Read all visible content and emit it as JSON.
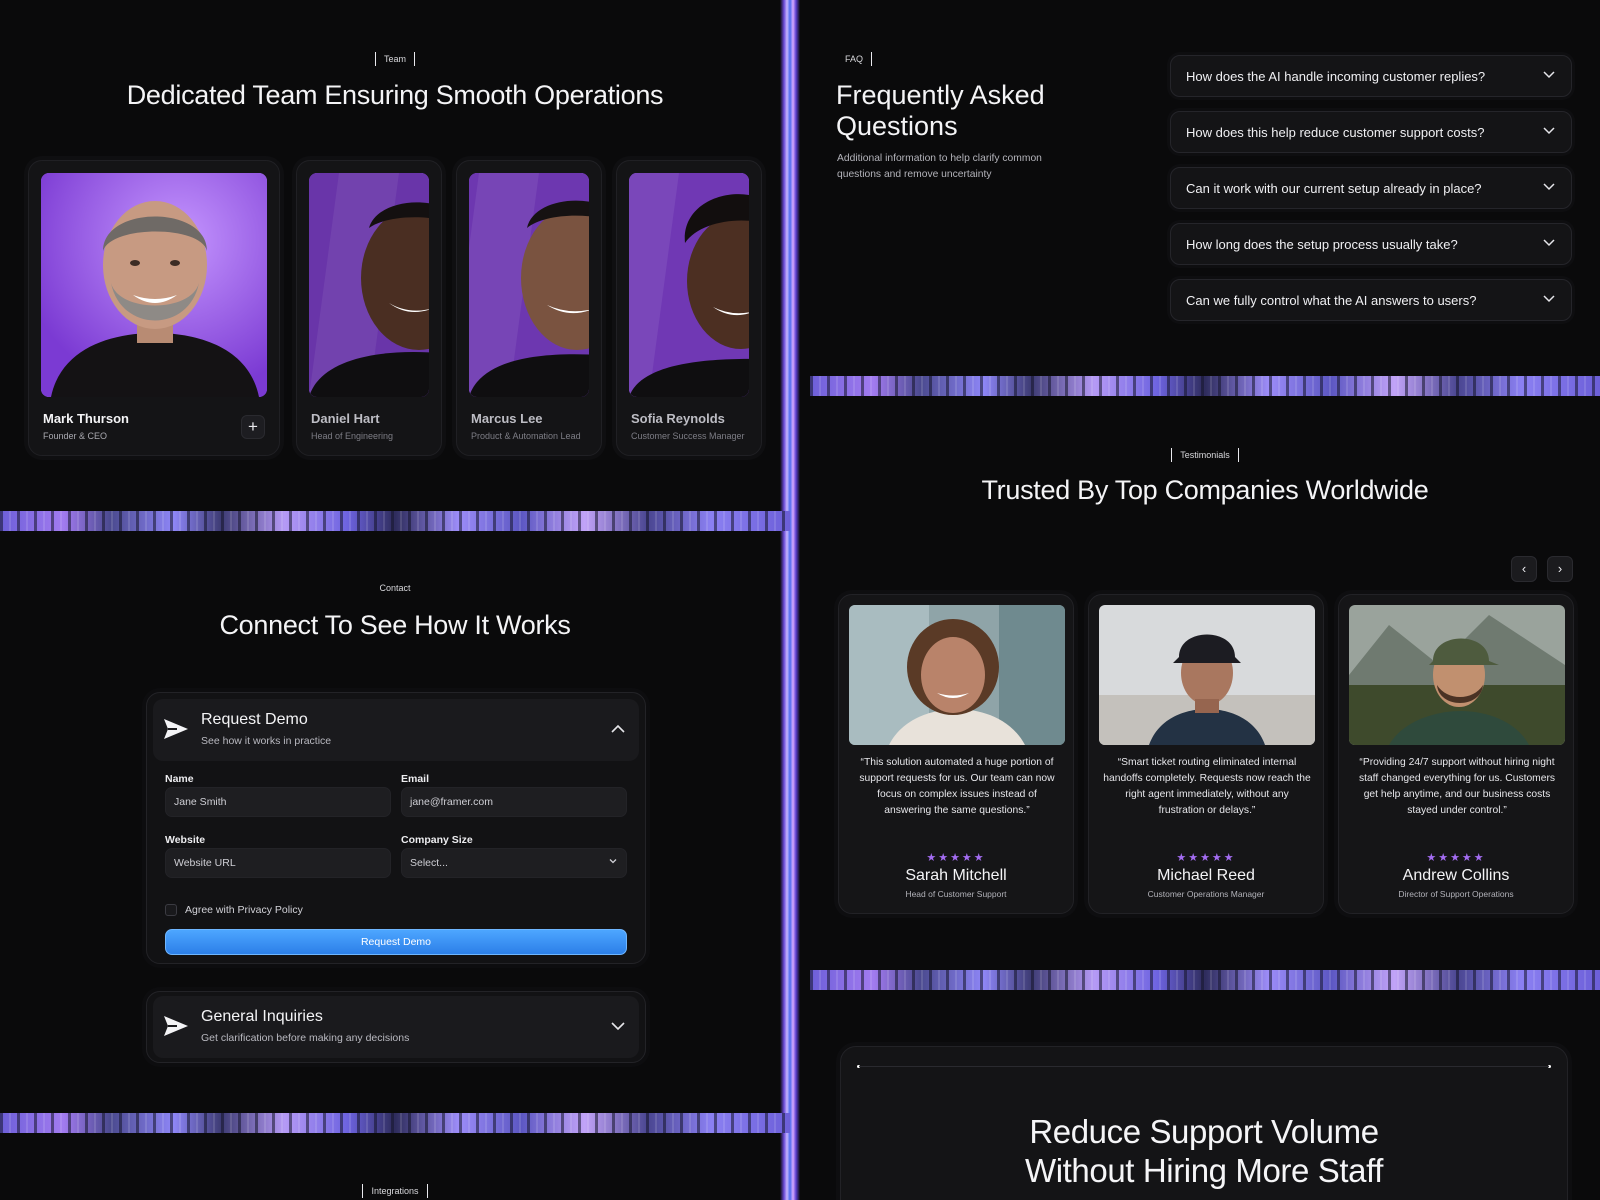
{
  "team": {
    "eyebrow": "Team",
    "title": "Dedicated Team Ensuring Smooth Operations",
    "members": [
      {
        "name": "Mark Thurson",
        "role": "Founder & CEO"
      },
      {
        "name": "Daniel Hart",
        "role": "Head of Engineering"
      },
      {
        "name": "Marcus Lee",
        "role": "Product & Automation Lead"
      },
      {
        "name": "Sofia Reynolds",
        "role": "Customer Success Manager"
      }
    ],
    "expand_symbol": "+"
  },
  "contact": {
    "eyebrow": "Contact",
    "title": "Connect To See How It Works",
    "demo": {
      "title": "Request Demo",
      "subtitle": "See how it works in practice",
      "name_label": "Name",
      "name_value": "Jane Smith",
      "email_label": "Email",
      "email_value": "jane@framer.com",
      "website_label": "Website",
      "website_placeholder": "Website URL",
      "size_label": "Company Size",
      "size_value": "Select...",
      "privacy_label": "Agree with Privacy Policy",
      "submit_label": "Request Demo"
    },
    "general": {
      "title": "General Inquiries",
      "subtitle": "Get clarification before making any decisions"
    }
  },
  "integrations": {
    "eyebrow": "Integrations"
  },
  "faq": {
    "eyebrow": "FAQ",
    "title_line1": "Frequently Asked",
    "title_line2": "Questions",
    "subtitle_line1": "Additional information to help clarify common",
    "subtitle_line2": "questions and remove uncertainty",
    "questions": [
      "How does the AI handle incoming customer replies?",
      "How does this help reduce customer support costs?",
      "Can it work with our current setup already in place?",
      "How long does the setup process usually take?",
      "Can we fully control what the AI answers to users?"
    ]
  },
  "testimonials": {
    "eyebrow": "Testimonials",
    "title": "Trusted By Top Companies Worldwide",
    "prev_symbol": "‹",
    "next_symbol": "›",
    "items": [
      {
        "quote": "“This solution automated a huge portion of support requests for us. Our team can now focus on complex issues instead of answering the same questions.”",
        "stars": "★★★★★",
        "rating": 5,
        "name": "Sarah Mitchell",
        "role": "Head of Customer Support"
      },
      {
        "quote": "“Smart ticket routing eliminated internal handoffs completely. Requests now reach the right agent immediately, without any frustration or delays.”",
        "stars": "★★★★★",
        "rating": 5,
        "name": "Michael Reed",
        "role": "Customer Operations Manager"
      },
      {
        "quote": "“Providing 24/7 support without hiring night staff changed everything for us. Customers get help anytime, and our business costs stayed under control.”",
        "stars": "★★★★★",
        "rating": 5,
        "name": "Andrew Collins",
        "role": "Director of Support Operations"
      }
    ]
  },
  "cta": {
    "line1": "Reduce Support Volume",
    "line2": "Without Hiring More Staff"
  },
  "colors": {
    "background": "#0a0a0b",
    "accent_purple": "#a36cf2",
    "button_blue": "#3a93f5"
  },
  "icons": {
    "send": "paper-plane-icon",
    "chevron_down": "chevron-down-icon",
    "chevron_up": "chevron-up-icon",
    "plus": "plus-icon",
    "arrow_left": "arrow-left-icon",
    "arrow_right": "arrow-right-icon",
    "star": "star-icon"
  }
}
